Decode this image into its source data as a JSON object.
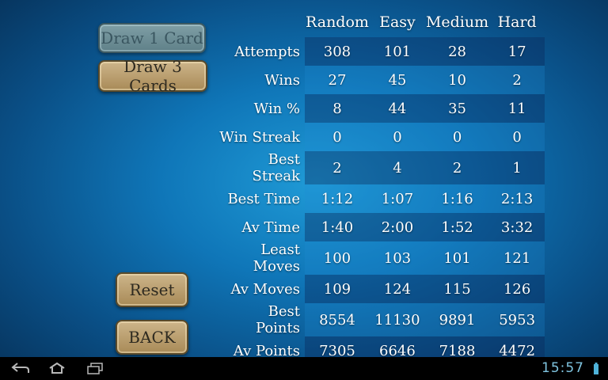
{
  "buttons": {
    "draw1": "Draw 1 Card",
    "draw3": "Draw 3 Cards",
    "reset": "Reset",
    "back": "BACK"
  },
  "stats": {
    "columns": [
      "Random",
      "Easy",
      "Medium",
      "Hard"
    ],
    "rows": [
      {
        "label": "Attempts",
        "values": [
          "308",
          "101",
          "28",
          "17"
        ]
      },
      {
        "label": "Wins",
        "values": [
          "27",
          "45",
          "10",
          "2"
        ]
      },
      {
        "label": "Win %",
        "values": [
          "8",
          "44",
          "35",
          "11"
        ]
      },
      {
        "label": "Win Streak",
        "values": [
          "0",
          "0",
          "0",
          "0"
        ]
      },
      {
        "label": "Best Streak",
        "values": [
          "2",
          "4",
          "2",
          "1"
        ]
      },
      {
        "label": "Best Time",
        "values": [
          "1:12",
          "1:07",
          "1:16",
          "2:13"
        ]
      },
      {
        "label": "Av Time",
        "values": [
          "1:40",
          "2:00",
          "1:52",
          "3:32"
        ]
      },
      {
        "label": "Least Moves",
        "values": [
          "100",
          "103",
          "101",
          "121"
        ]
      },
      {
        "label": "Av Moves",
        "values": [
          "109",
          "124",
          "115",
          "126"
        ]
      },
      {
        "label": "Best Points",
        "values": [
          "8554",
          "11130",
          "9891",
          "5953"
        ]
      },
      {
        "label": "Av Points",
        "values": [
          "7305",
          "6646",
          "7188",
          "4472"
        ]
      }
    ]
  },
  "status_bar": {
    "time": "15:57",
    "icons": [
      "back-icon",
      "home-icon",
      "recent-apps-icon",
      "battery-icon"
    ]
  }
}
